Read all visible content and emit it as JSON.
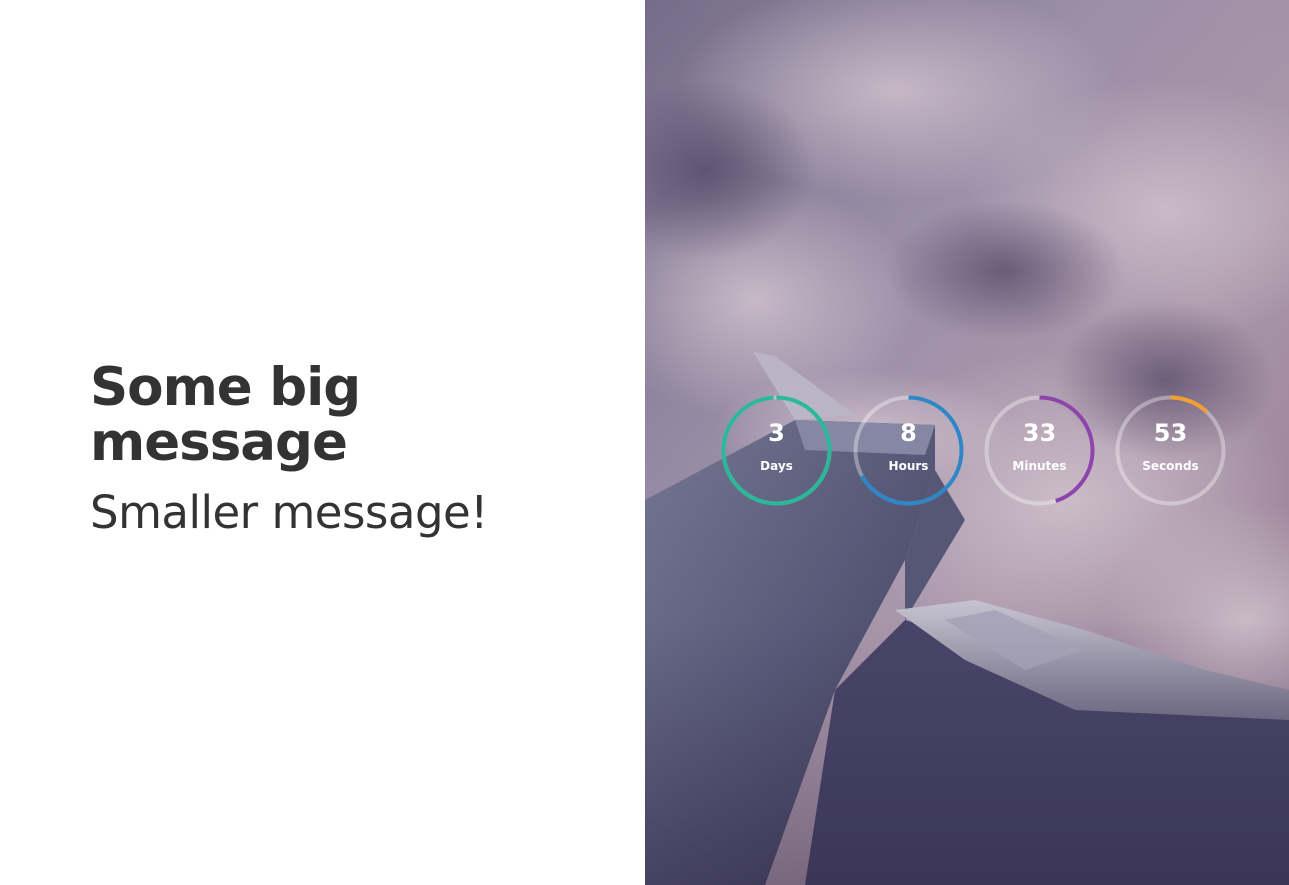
{
  "left_panel": {
    "headline": "Some big message",
    "subheadline": "Smaller message!"
  },
  "countdown": {
    "days": {
      "value": "3",
      "label": "Days",
      "progress": 0.99,
      "color": "#2bb89a"
    },
    "hours": {
      "value": "8",
      "label": "Hours",
      "progress": 0.67,
      "color": "#2f86c6"
    },
    "minutes": {
      "value": "33",
      "label": "Minutes",
      "progress": 0.45,
      "color": "#8e44ad"
    },
    "seconds": {
      "value": "53",
      "label": "Seconds",
      "progress": 0.12,
      "color": "#f0a030"
    }
  },
  "background_image": "airplane-wing-over-clouds"
}
